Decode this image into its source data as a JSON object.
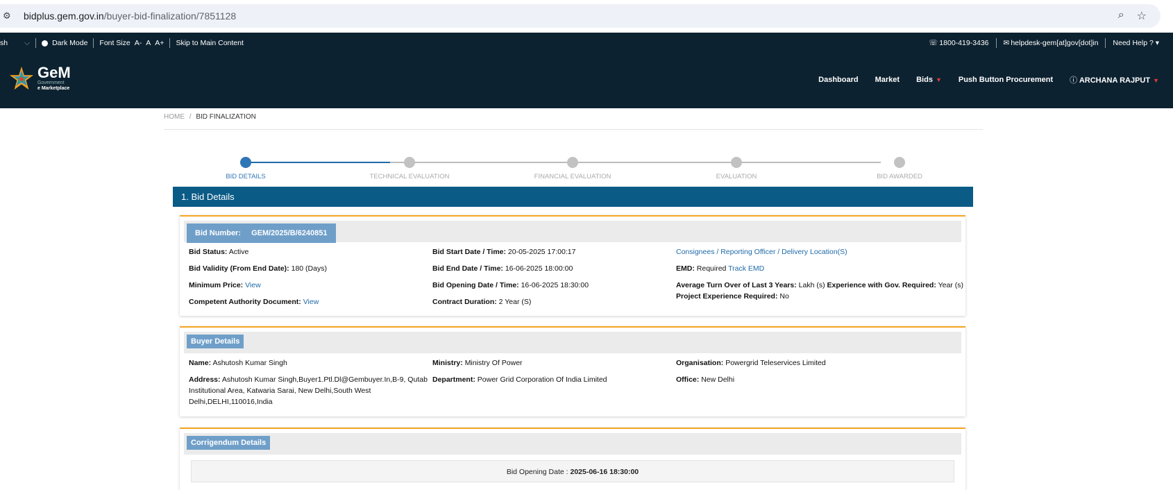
{
  "browser": {
    "url_host": "bidplus.gem.gov.in",
    "url_path": "/buyer-bid-finalization/7851128"
  },
  "topbar": {
    "language": "sh",
    "dark_mode": "Dark Mode",
    "font_size_label": "Font Size",
    "font_small": "A-",
    "font_normal": "A",
    "font_large": "A+",
    "skip": "Skip to Main Content",
    "phone": "1800-419-3436",
    "email": "helpdesk-gem[at]gov[dot]in",
    "need_help": "Need Help ?"
  },
  "logo": {
    "name": "GeM",
    "line1": "Government",
    "line2": "e Marketplace"
  },
  "nav": {
    "dashboard": "Dashboard",
    "market": "Market",
    "bids": "Bids",
    "push_button": "Push Button Procurement",
    "user": "ARCHANA RAJPUT"
  },
  "breadcrumb": {
    "home": "HOME",
    "sep": "/",
    "current": "BID FINALIZATION"
  },
  "steps": [
    "BID DETAILS",
    "TECHNICAL EVALUATION",
    "FINANCIAL EVALUATION",
    "EVALUATION",
    "BID AWARDED"
  ],
  "section_title": "1. Bid Details",
  "bid": {
    "header_label": "Bid Number:",
    "header_value": "GEM/2025/B/6240851",
    "status_label": "Bid Status:",
    "status_value": "Active",
    "validity_label": "Bid Validity (From End Date):",
    "validity_value": "180 (Days)",
    "min_price_label": "Minimum Price:",
    "min_price_link": "View",
    "cad_label": "Competent Authority Document:",
    "cad_link": "View",
    "start_label": "Bid Start Date / Time:",
    "start_value": "20-05-2025 17:00:17",
    "end_label": "Bid End Date / Time:",
    "end_value": "16-06-2025 18:00:00",
    "opening_label": "Bid Opening Date / Time:",
    "opening_value": "16-06-2025 18:30:00",
    "duration_label": "Contract Duration:",
    "duration_value": "2 Year (S)",
    "consignees_link": "Consignees / Reporting Officer / Delivery Location(S)",
    "emd_label": "EMD:",
    "emd_value": "Required",
    "emd_link": "Track EMD",
    "turnover_label": "Average Turn Over of Last 3 Years:",
    "turnover_value": "Lakh (s)",
    "exp_label": "Experience with Gov. Required:",
    "exp_value": "Year (s)",
    "proj_label": "Project Experience Required:",
    "proj_value": "No"
  },
  "buyer": {
    "header": "Buyer Details",
    "name_label": "Name:",
    "name_value": "Ashutosh Kumar Singh",
    "address_label": "Address:",
    "address_value": "Ashutosh Kumar Singh,Buyer1.Ptl.Dl@Gembuyer.In,B-9, Qutab Institutional Area, Katwaria Sarai, New Delhi,South West Delhi,DELHI,110016,India",
    "ministry_label": "Ministry:",
    "ministry_value": "Ministry Of Power",
    "department_label": "Department:",
    "department_value": "Power Grid Corporation Of India Limited",
    "org_label": "Organisation:",
    "org_value": "Powergrid Teleservices Limited",
    "office_label": "Office:",
    "office_value": "New Delhi"
  },
  "corrigendum": {
    "header": "Corrigendum Details",
    "label": "Bid Opening Date :",
    "value": "2025-06-16 18:30:00"
  }
}
